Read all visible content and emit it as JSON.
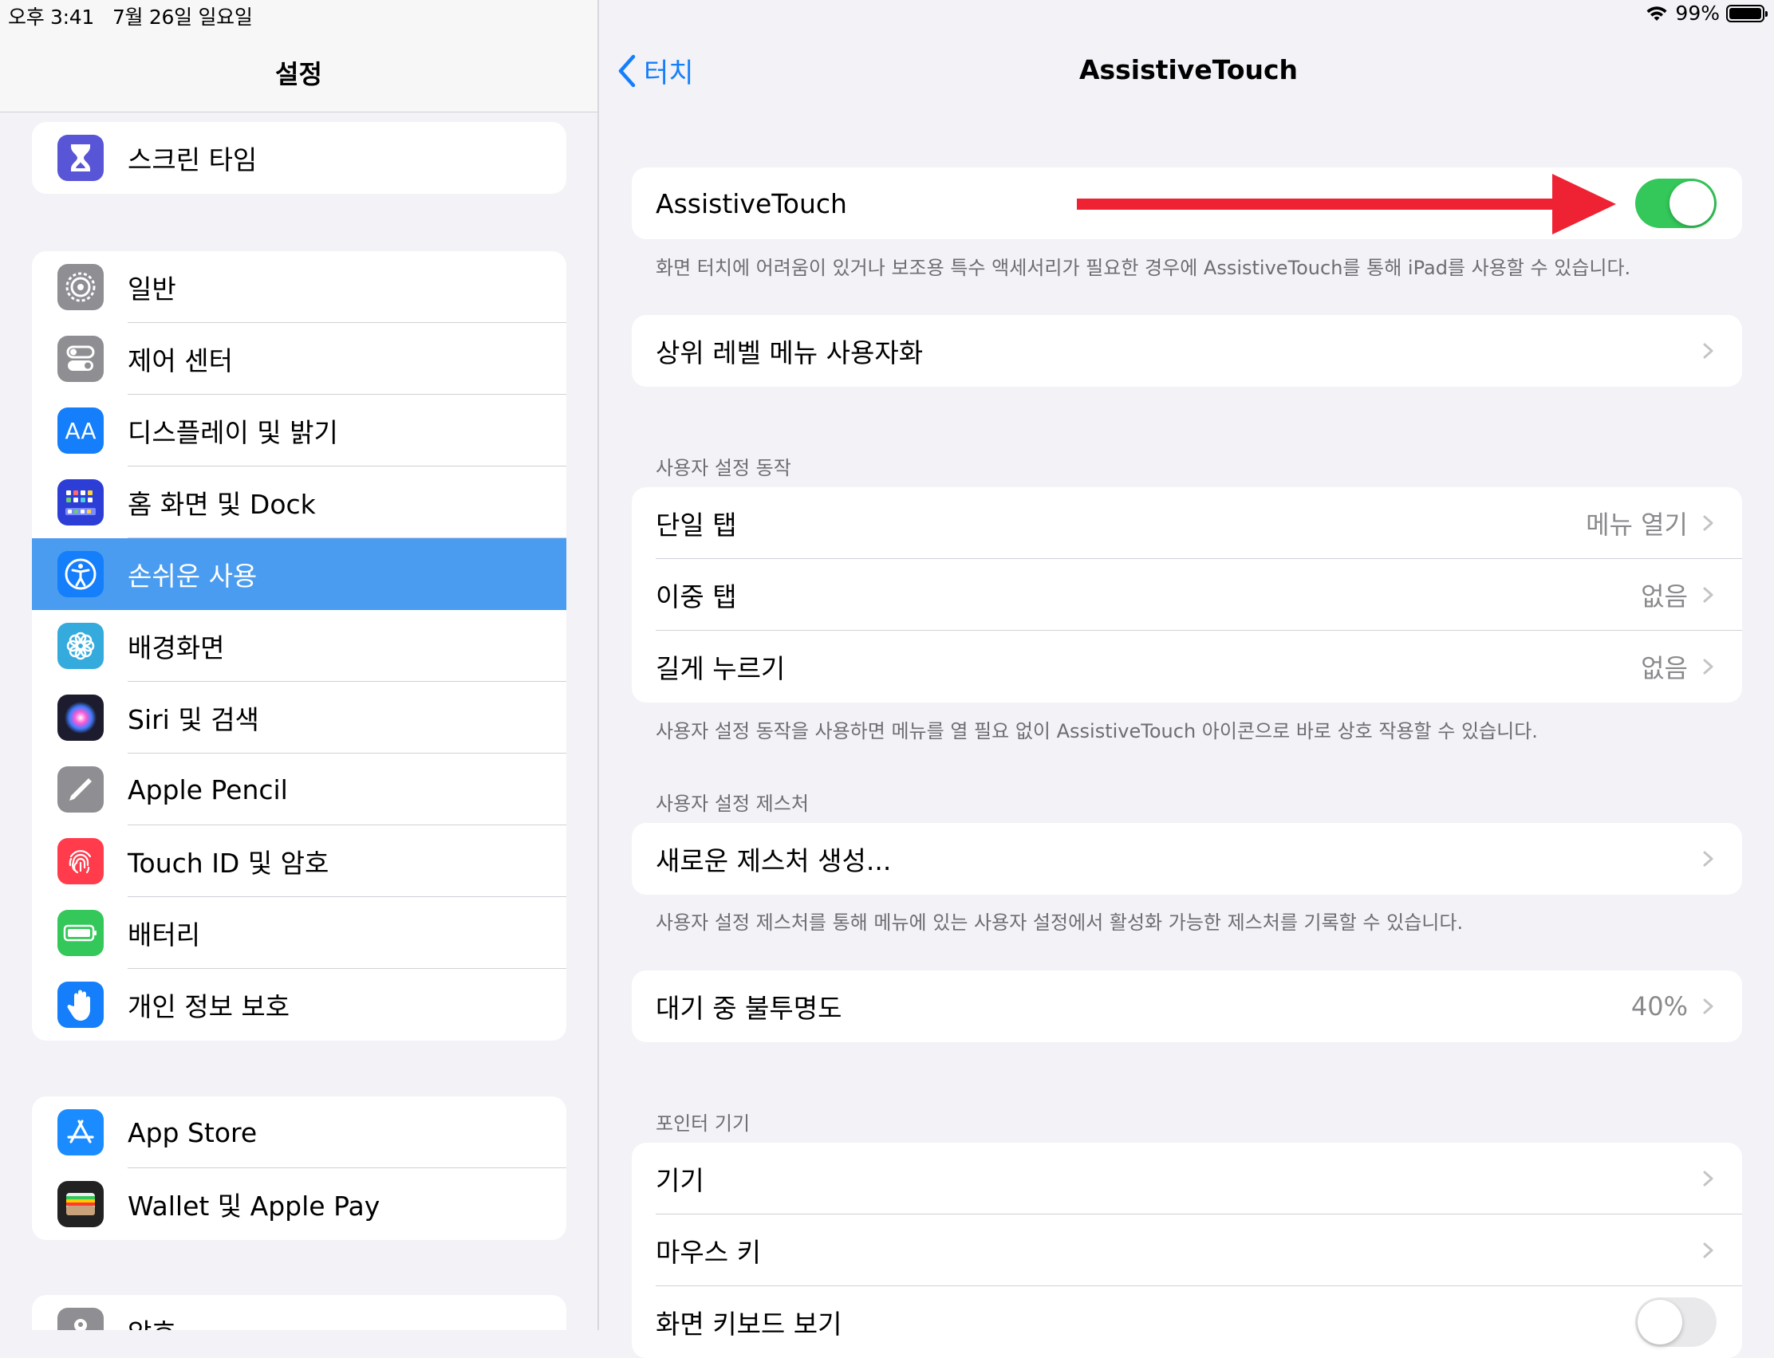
{
  "status": {
    "time": "오후 3:41",
    "date": "7월 26일 일요일",
    "battery": "99%",
    "battery_level": 0.99
  },
  "sidebar": {
    "title": "설정",
    "group1": [
      {
        "label": "스크린 타임",
        "icon": "hourglass-icon",
        "color": "#5856d6"
      }
    ],
    "group2": [
      {
        "label": "일반",
        "icon": "gear-icon",
        "color": "#8e8e93"
      },
      {
        "label": "제어 센터",
        "icon": "switches-icon",
        "color": "#8e8e93"
      },
      {
        "label": "디스플레이 및 밝기",
        "icon": "text-size-icon",
        "color": "#147efb"
      },
      {
        "label": "홈 화면 및 Dock",
        "icon": "home-grid-icon",
        "color": "#2c3ed6"
      },
      {
        "label": "손쉬운 사용",
        "icon": "accessibility-icon",
        "color": "#147efb",
        "selected": true
      },
      {
        "label": "배경화면",
        "icon": "flower-icon",
        "color": "#35aadc"
      },
      {
        "label": "Siri 및 검색",
        "icon": "siri-icon",
        "color": "#222"
      },
      {
        "label": "Apple Pencil",
        "icon": "pencil-icon",
        "color": "#8e8e93"
      },
      {
        "label": "Touch ID 및 암호",
        "icon": "fingerprint-icon",
        "color": "#ff3b4c"
      },
      {
        "label": "배터리",
        "icon": "battery-icon",
        "color": "#34c759"
      },
      {
        "label": "개인 정보 보호",
        "icon": "hand-icon",
        "color": "#147efb"
      }
    ],
    "group3": [
      {
        "label": "App Store",
        "icon": "app-store-icon",
        "color": "#1a8cff"
      },
      {
        "label": "Wallet 및 Apple Pay",
        "icon": "wallet-icon",
        "color": "#222"
      }
    ],
    "group4": [
      {
        "label": "암호",
        "icon": "key-icon",
        "color": "#8e8e93"
      }
    ]
  },
  "detail": {
    "back_label": "터치",
    "title": "AssistiveTouch",
    "main_toggle": {
      "label": "AssistiveTouch",
      "on": true
    },
    "main_footer": "화면 터치에 어려움이 있거나 보조용 특수 액세서리가 필요한 경우에 AssistiveTouch를 통해 iPad를 사용할 수 있습니다.",
    "top_menu": "상위 레벨 메뉴 사용자화",
    "custom_actions_header": "사용자 설정 동작",
    "custom_actions": [
      {
        "label": "단일 탭",
        "value": "메뉴 열기"
      },
      {
        "label": "이중 탭",
        "value": "없음"
      },
      {
        "label": "길게 누르기",
        "value": "없음"
      }
    ],
    "custom_actions_footer": "사용자 설정 동작을 사용하면 메뉴를 열 필요 없이 AssistiveTouch 아이콘으로 바로 상호 작용할 수 있습니다.",
    "custom_gestures_header": "사용자 설정 제스처",
    "new_gesture": "새로운 제스처 생성...",
    "custom_gestures_footer": "사용자 설정 제스처를 통해 메뉴에 있는 사용자 설정에서 활성화 가능한 제스처를 기록할 수 있습니다.",
    "idle_opacity": {
      "label": "대기 중 불투명도",
      "value": "40%"
    },
    "pointer_header": "포인터 기기",
    "pointer_items": [
      {
        "label": "기기"
      },
      {
        "label": "마우스 키"
      }
    ],
    "onscreen_keyboard": {
      "label": "화면 키보드 보기",
      "on": false
    }
  },
  "annotation": {
    "arrow_color": "#ee2233"
  }
}
